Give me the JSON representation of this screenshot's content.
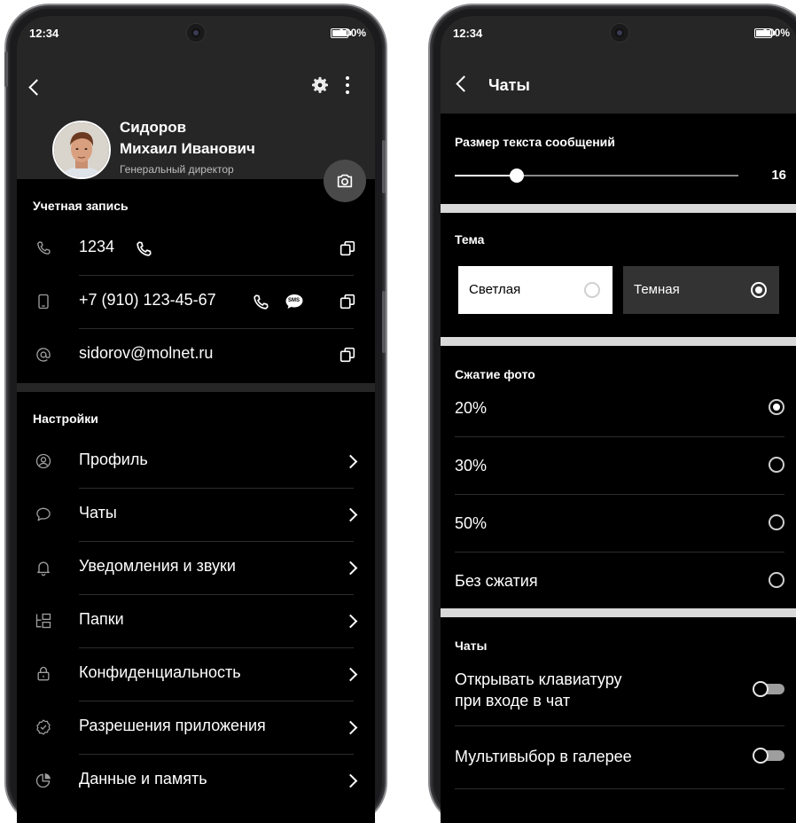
{
  "left_phone": {
    "status": {
      "time": "12:34",
      "battery": "100%"
    },
    "profile": {
      "last_name": "Сидоров",
      "first_middle": "Михаил Иванович",
      "position": "Генеральный директор"
    },
    "account": {
      "title": "Учетная запись",
      "internal_number": "1234",
      "mobile": "+7 (910) 123-45-67",
      "email": "sidorov@molnet.ru",
      "sms_label": "SMS"
    },
    "settings": {
      "title": "Настройки",
      "items": [
        {
          "label": "Профиль",
          "icon": "user-circle-icon"
        },
        {
          "label": "Чаты",
          "icon": "chat-bubble-icon"
        },
        {
          "label": "Уведомления и звуки",
          "icon": "bell-icon"
        },
        {
          "label": "Папки",
          "icon": "folders-icon"
        },
        {
          "label": "Конфиденциальность",
          "icon": "lock-icon"
        },
        {
          "label": "Разрешения приложения",
          "icon": "check-badge-icon"
        },
        {
          "label": "Данные и память",
          "icon": "pie-chart-icon"
        }
      ]
    }
  },
  "right_phone": {
    "status": {
      "time": "12:34",
      "battery": "100%"
    },
    "header": {
      "title": "Чаты"
    },
    "text_size": {
      "label": "Размер текста сообщений",
      "value": "16",
      "level": 0.22
    },
    "theme": {
      "title": "Тема",
      "light_label": "Светлая",
      "dark_label": "Темная",
      "selected": "dark"
    },
    "photo_compression": {
      "title": "Сжатие фото",
      "options": [
        "20%",
        "30%",
        "50%",
        "Без сжатия"
      ],
      "selected_index": 0
    },
    "chats": {
      "title": "Чаты",
      "open_keyboard_line1": "Открывать клавиатуру",
      "open_keyboard_line2": "при входе в чат",
      "open_keyboard_on": false,
      "multiselect_label": "Мультивыбор в галерее",
      "multiselect_on": false
    }
  }
}
